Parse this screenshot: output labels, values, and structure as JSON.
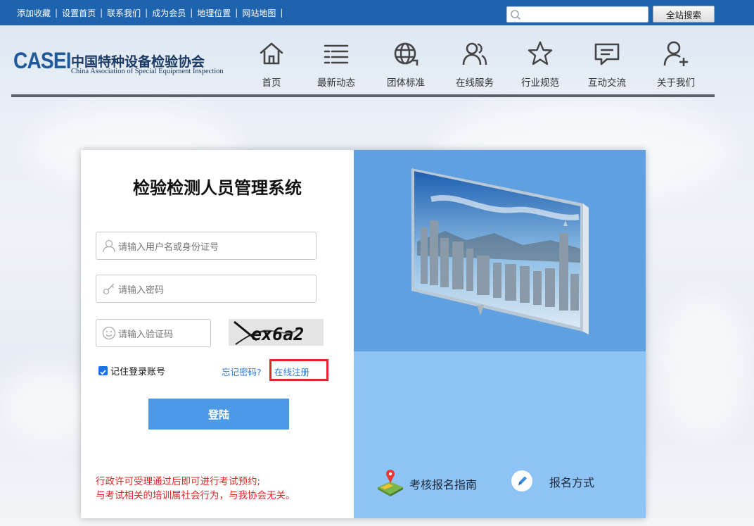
{
  "toplinks": [
    "添加收藏",
    "设置首页",
    "联系我们",
    "成为会员",
    "地理位置",
    "网站地图"
  ],
  "search": {
    "placeholder": "",
    "button_label": "全站搜索"
  },
  "logo": {
    "abbr": "CASEI",
    "name_cn": "中国特种设备检验协会",
    "name_en": "China Association of Special Equipment Inspection"
  },
  "nav": [
    {
      "label": "首页",
      "icon": "home-icon"
    },
    {
      "label": "最新动态",
      "icon": "list-icon"
    },
    {
      "label": "团体标准",
      "icon": "globe-icon"
    },
    {
      "label": "在线服务",
      "icon": "users-icon"
    },
    {
      "label": "行业规范",
      "icon": "star-icon"
    },
    {
      "label": "互动交流",
      "icon": "chat-icon"
    },
    {
      "label": "关于我们",
      "icon": "user-plus-icon"
    }
  ],
  "login": {
    "title": "检验检测人员管理系统",
    "username_placeholder": "请输入用户名或身份证号",
    "password_placeholder": "请输入密码",
    "captcha_placeholder": "请输入验证码",
    "captcha_text": "ex6a2",
    "remember_label": "记住登录账号",
    "remember_checked": true,
    "forgot_label": "忘记密码?",
    "register_label": "在线注册",
    "submit_label": "登陆",
    "notice_lines": [
      "行政许可受理通过后即可进行考试预约;",
      "与考试相关的培训属社会行为，与我协会无关。"
    ]
  },
  "side": {
    "guide_label": "考核报名指南",
    "method_label": "报名方式"
  },
  "colors": {
    "topbar": "#1d63ad",
    "accent": "#4a9ae8",
    "notice": "#e02525",
    "highlight": "#e0262b"
  }
}
